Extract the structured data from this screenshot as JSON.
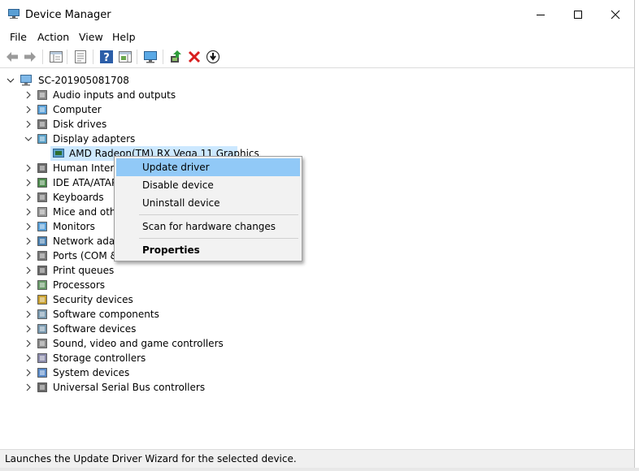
{
  "window": {
    "title": "Device Manager"
  },
  "menu": {
    "file": "File",
    "action": "Action",
    "view": "View",
    "help": "Help"
  },
  "toolbar": {
    "icons": [
      "back-arrow-icon",
      "forward-arrow-icon",
      "show-hide-tree-icon",
      "properties-icon",
      "help-icon",
      "action-pane-icon",
      "computer-monitor-icon",
      "update-driver-icon",
      "uninstall-icon",
      "download-icon"
    ]
  },
  "tree": {
    "root": "SC-201905081708",
    "items": [
      {
        "label": "Audio inputs and outputs",
        "expanded": false
      },
      {
        "label": "Computer",
        "expanded": false
      },
      {
        "label": "Disk drives",
        "expanded": false
      },
      {
        "label": "Display adapters",
        "expanded": true
      },
      {
        "label": "Human Interfa",
        "expanded": false
      },
      {
        "label": "IDE ATA/ATAP",
        "expanded": false
      },
      {
        "label": "Keyboards",
        "expanded": false
      },
      {
        "label": "Mice and othe",
        "expanded": false
      },
      {
        "label": "Monitors",
        "expanded": false
      },
      {
        "label": "Network adap",
        "expanded": false
      },
      {
        "label": "Ports (COM &",
        "expanded": false
      },
      {
        "label": "Print queues",
        "expanded": false
      },
      {
        "label": "Processors",
        "expanded": false
      },
      {
        "label": "Security devices",
        "expanded": false
      },
      {
        "label": "Software components",
        "expanded": false
      },
      {
        "label": "Software devices",
        "expanded": false
      },
      {
        "label": "Sound, video and game controllers",
        "expanded": false
      },
      {
        "label": "Storage controllers",
        "expanded": false
      },
      {
        "label": "System devices",
        "expanded": false
      },
      {
        "label": "Universal Serial Bus controllers",
        "expanded": false
      }
    ],
    "child": "AMD Radeon(TM) RX Vega 11 Graphics"
  },
  "context_menu": {
    "update": "Update driver",
    "disable": "Disable device",
    "uninstall": "Uninstall device",
    "scan": "Scan for hardware changes",
    "properties": "Properties"
  },
  "status": "Launches the Update Driver Wizard for the selected device."
}
